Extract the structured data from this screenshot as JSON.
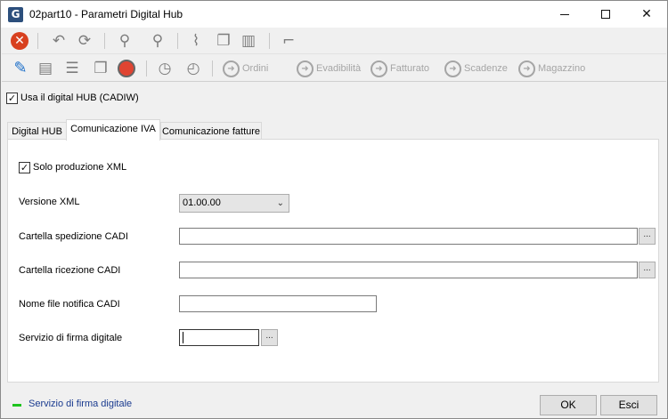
{
  "window": {
    "title": "02part10 - Parametri Digital Hub",
    "app_icon_letter": "G",
    "minimize": "minimize",
    "maximize": "maximize",
    "close": "✕"
  },
  "toolbar1": {
    "icons": [
      "close-icon",
      "undo-icon",
      "refresh-icon",
      "binoculars-icon",
      "binoculars-next-icon",
      "paperclip-icon",
      "copy-docs-icon",
      "layout-icon",
      "note-icon"
    ]
  },
  "toolbar2": {
    "icons": [
      "pencil-icon",
      "document-icon",
      "list-icon",
      "copy-icon",
      "face-icon",
      "history-icon",
      "history-back-icon"
    ],
    "nav_buttons": [
      "Ordini",
      "Evadibilità",
      "Fatturato",
      "Scadenze",
      "Magazzino"
    ]
  },
  "use_digital_hub": {
    "label": "Usa il digital HUB (CADIW)",
    "checked": true
  },
  "tabs": [
    "Digital HUB",
    "Comunicazione IVA",
    "Comunicazione fatture"
  ],
  "active_tab": "Comunicazione IVA",
  "form": {
    "solo_xml": {
      "label": "Solo produzione XML",
      "checked": true
    },
    "versione_xml": {
      "label": "Versione XML",
      "value": "01.00.00"
    },
    "cartella_spedizione": {
      "label": "Cartella spedizione CADI",
      "value": "",
      "browse": "..."
    },
    "cartella_ricezione": {
      "label": "Cartella ricezione CADI",
      "value": "",
      "browse": "..."
    },
    "nome_file_notifica": {
      "label": "Nome file notifica CADI",
      "value": ""
    },
    "servizio_firma": {
      "label": "Servizio di firma digitale",
      "value": "",
      "browse": "..."
    }
  },
  "status": {
    "text": "Servizio di firma digitale",
    "color": "#1fc41f"
  },
  "buttons": {
    "ok": "OK",
    "esci": "Esci"
  }
}
